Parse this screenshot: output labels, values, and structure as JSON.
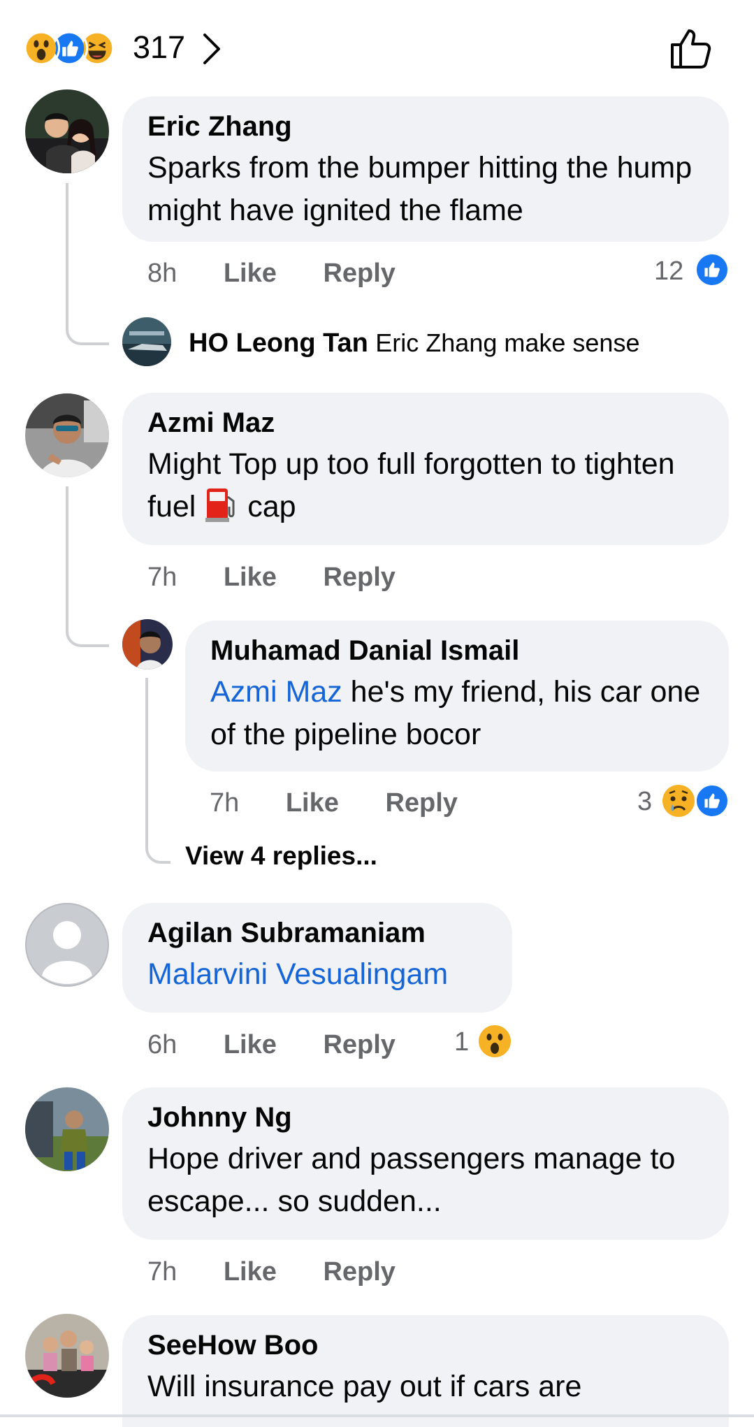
{
  "header": {
    "reaction_count": "317",
    "reaction_icons": [
      "wow-icon",
      "like-icon",
      "haha-icon"
    ]
  },
  "actions": {
    "like": "Like",
    "reply": "Reply"
  },
  "comments": [
    {
      "name": "Eric Zhang",
      "text": "Sparks from the bumper hitting the hump might have ignited the flame",
      "time": "8h",
      "reaction_count": "12",
      "reply_preview": {
        "name": "HO Leong Tan",
        "text": "Eric Zhang make sense"
      }
    },
    {
      "name": "Azmi Maz",
      "text_before": "Might Top up too full forgotten to tighten fuel",
      "text_after": "cap",
      "emoji": "fuel-pump-icon",
      "time": "7h",
      "reply": {
        "name": "Muhamad Danial Ismail",
        "mention": "Azmi Maz",
        "text": " he's my friend,  his car one of the pipeline bocor",
        "time": "7h",
        "reaction_count": "3"
      },
      "view_replies": "View 4 replies..."
    },
    {
      "name": "Agilan Subramaniam",
      "mention": "Malarvini Vesualingam",
      "time": "6h",
      "reaction_count": "1"
    },
    {
      "name": "Johnny Ng",
      "text": "Hope driver and passengers manage to escape... so sudden...",
      "time": "7h"
    },
    {
      "name": "SeeHow Boo",
      "text": "Will insurance pay out if cars are"
    }
  ],
  "colors": {
    "bubble": "#f0f2f5",
    "meta": "#65676b",
    "mention": "#1565d8",
    "like_blue": "#1877f2",
    "thread_line": "#ced0d4"
  }
}
